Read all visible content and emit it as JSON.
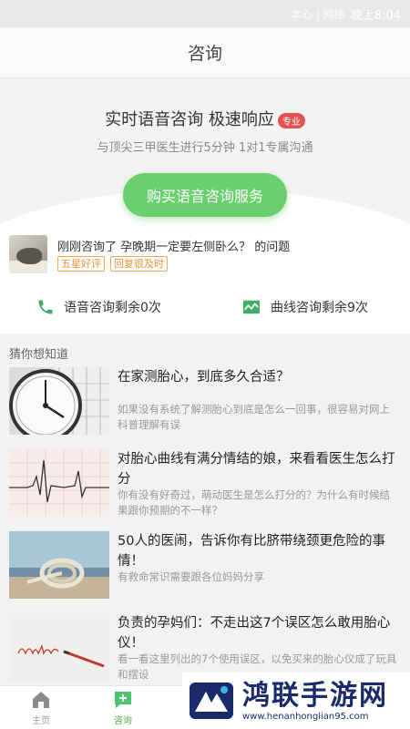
{
  "status": {
    "carrier": "本心 | 网络",
    "time": "晚上8:04"
  },
  "nav": {
    "title": "咨询"
  },
  "hero": {
    "headline": "实时语音咨询 极速响应",
    "tag": "专业",
    "subline": "与顶尖三甲医生进行5分钟 1对1专属沟通",
    "buy_button": "购买语音咨询服务"
  },
  "recent": {
    "text": "刚刚咨询了 孕晚期一定要左侧卧么？ 的问题",
    "badges": [
      "五星好评",
      "回复很及时"
    ]
  },
  "counters": [
    {
      "label": "语音咨询剩余0次",
      "icon": "phone-icon"
    },
    {
      "label": "曲线咨询剩余9次",
      "icon": "chart-curve-icon"
    }
  ],
  "guess": {
    "title": "猜你想知道"
  },
  "articles": [
    {
      "title": "在家测胎心，到底多久合适？",
      "desc": "如果没有系统了解测胎心到底是怎么一回事，很容易对网上科普理解有误",
      "thumb": "clock-calendar"
    },
    {
      "title": "对胎心曲线有满分情结的娘，来看看医生怎么打分",
      "desc": "你有没有好奇过，萌动医生是怎么打分的？为什么有时候结果跟你预期的不一样？",
      "thumb": "heart-trace"
    },
    {
      "title": "50人的医闹，告诉你有比脐带绕颈更危险的事情！",
      "desc": "有救命常识需要跟各位妈妈分享",
      "thumb": "rope-knot"
    },
    {
      "title": "负责的孕妈们：不走出这7个误区怎么敢用胎心仪！",
      "desc": "看一看这里列出的7个使用误区，以免买来的胎心仪成了玩具和摆设",
      "thumb": "mistake-pencil"
    }
  ],
  "tabs": [
    {
      "label": "主页",
      "icon": "home-icon",
      "active": false
    },
    {
      "label": "咨询",
      "icon": "chat-plus-icon",
      "active": true
    }
  ],
  "watermark": {
    "name": "鸿联手游网",
    "url": "www.henanhonglian95.com"
  },
  "colors": {
    "accent_green": "#6ad06e",
    "tag_red": "#e2534f",
    "badge_orange": "#e8913a"
  }
}
